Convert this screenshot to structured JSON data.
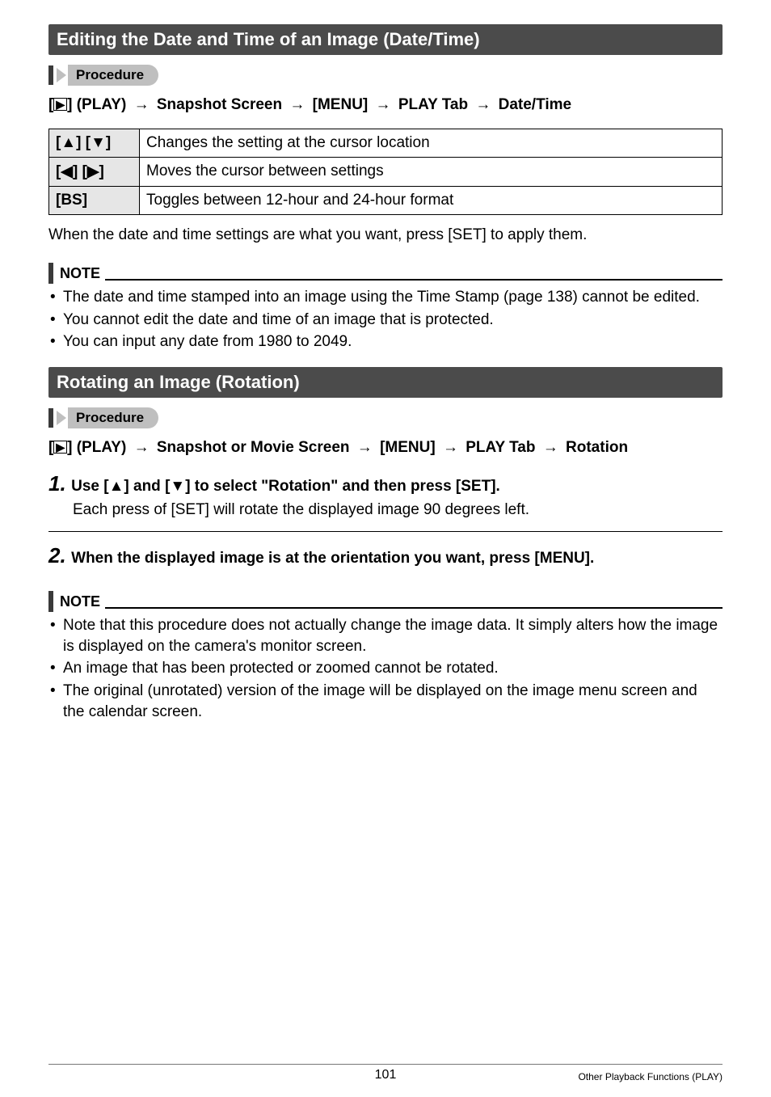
{
  "section1": {
    "heading": "Editing the Date and Time of an Image (Date/Time)",
    "procedure_label": "Procedure",
    "path_parts": [
      "] (PLAY)",
      "Snapshot Screen",
      "[MENU]",
      "PLAY Tab",
      "Date/Time"
    ],
    "path_prefix": "[",
    "play_glyph": "▶",
    "table": {
      "rows": [
        {
          "key_left": "[▲] [▼]",
          "desc": "Changes the setting at the cursor location"
        },
        {
          "key_left": "[◀] [▶]",
          "desc": "Moves the cursor between settings"
        },
        {
          "key_left": "[BS]",
          "desc": "Toggles between 12-hour and 24-hour format"
        }
      ]
    },
    "apply_text": "When the date and time settings are what you want, press [SET] to apply them.",
    "note_label": "NOTE",
    "notes": [
      "The date and time stamped into an image using the Time Stamp (page 138) cannot be edited.",
      "You cannot edit the date and time of an image that is protected.",
      "You can input any date from 1980 to 2049."
    ]
  },
  "section2": {
    "heading": "Rotating an Image (Rotation)",
    "procedure_label": "Procedure",
    "path_parts": [
      "] (PLAY)",
      "Snapshot or Movie Screen",
      "[MENU]",
      "PLAY Tab",
      "Rotation"
    ],
    "path_prefix": "[",
    "play_glyph": "▶",
    "step1_title": "Use [▲] and [▼] to select \"Rotation\" and then press [SET].",
    "step1_body": "Each press of [SET] will rotate the displayed image 90 degrees left.",
    "step2_title": "When the displayed image is at the orientation you want, press [MENU].",
    "note_label": "NOTE",
    "notes": [
      "Note that this procedure does not actually change the image data. It simply alters how the image is displayed on the camera's monitor screen.",
      "An image that has been protected or zoomed cannot be rotated.",
      "The original (unrotated) version of the image will be displayed on the image menu screen and the calendar screen."
    ]
  },
  "footer": {
    "page": "101",
    "section": "Other Playback Functions (PLAY)"
  },
  "glyphs": {
    "arrow_right": "→"
  }
}
